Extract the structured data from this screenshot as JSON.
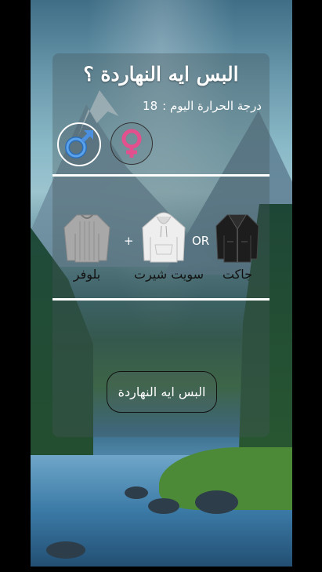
{
  "screen": {
    "title": "البس ايه النهاردة ؟",
    "temperature": {
      "label": "درجة الحرارة اليوم :",
      "value": "18"
    },
    "genders": [
      {
        "id": "male",
        "icon": "male-symbol-icon",
        "color": "#4a8fe0",
        "selected": true
      },
      {
        "id": "female",
        "icon": "female-symbol-icon",
        "color": "#e2508d",
        "selected": false
      }
    ],
    "outfit": {
      "items": [
        {
          "label": "بلوفر",
          "icon": "sweater-icon"
        },
        {
          "label": "سويت شيرت",
          "icon": "hoodie-icon"
        },
        {
          "label": "جاكت",
          "icon": "jacket-icon"
        }
      ],
      "separators": [
        "+",
        "OR"
      ]
    },
    "cta_label": "البس ايه النهاردة"
  }
}
